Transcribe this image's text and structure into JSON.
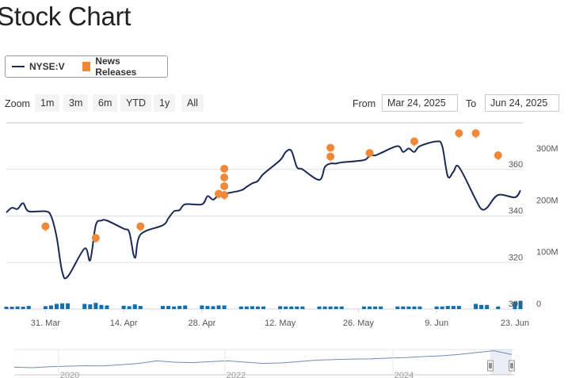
{
  "page": {
    "title": "Stock Chart"
  },
  "legend": {
    "series": "NYSE:V",
    "news": "News Releases"
  },
  "zoom": {
    "label": "Zoom",
    "buttons": [
      "1m",
      "3m",
      "6m",
      "YTD",
      "1y",
      "All"
    ]
  },
  "range": {
    "from_label": "From",
    "from_value": "Mar 24, 2025",
    "to_label": "To",
    "to_value": "Jun 24, 2025"
  },
  "colors": {
    "line": "#1a2a55",
    "news": "#f0883a",
    "volume": "#0f6ead",
    "navigator": "#6f8db8"
  },
  "chart_data": {
    "type": "line",
    "series": [
      {
        "name": "NYSE:V",
        "x": [
          "2025-03-24",
          "2025-03-25",
          "2025-03-26",
          "2025-03-27",
          "2025-03-28",
          "2025-03-31",
          "2025-04-01",
          "2025-04-02",
          "2025-04-03",
          "2025-04-04",
          "2025-04-07",
          "2025-04-08",
          "2025-04-09",
          "2025-04-10",
          "2025-04-11",
          "2025-04-14",
          "2025-04-15",
          "2025-04-16",
          "2025-04-17",
          "2025-04-21",
          "2025-04-22",
          "2025-04-23",
          "2025-04-24",
          "2025-04-25",
          "2025-04-28",
          "2025-04-29",
          "2025-04-30",
          "2025-05-01",
          "2025-05-02",
          "2025-05-05",
          "2025-05-06",
          "2025-05-07",
          "2025-05-08",
          "2025-05-09",
          "2025-05-12",
          "2025-05-13",
          "2025-05-14",
          "2025-05-15",
          "2025-05-16",
          "2025-05-19",
          "2025-05-20",
          "2025-05-21",
          "2025-05-22",
          "2025-05-23",
          "2025-05-27",
          "2025-05-28",
          "2025-05-29",
          "2025-05-30",
          "2025-06-02",
          "2025-06-03",
          "2025-06-04",
          "2025-06-05",
          "2025-06-06",
          "2025-06-09",
          "2025-06-10",
          "2025-06-11",
          "2025-06-12",
          "2025-06-13",
          "2025-06-16",
          "2025-06-17",
          "2025-06-18",
          "2025-06-20",
          "2025-06-23",
          "2025-06-24"
        ],
        "y": [
          341.5,
          343.5,
          343.0,
          345.5,
          342.0,
          342.0,
          340.0,
          331.0,
          316.0,
          314.0,
          326.0,
          321.0,
          336.0,
          338.0,
          338.0,
          334.5,
          333.0,
          322.0,
          332.0,
          336.0,
          339.0,
          342.0,
          342.5,
          345.0,
          345.0,
          348.5,
          347.0,
          349.0,
          349.5,
          351.0,
          352.5,
          354.0,
          355.0,
          358.0,
          364.0,
          367.5,
          368.0,
          361.0,
          360.0,
          355.5,
          361.0,
          362.5,
          362.5,
          363.0,
          364.0,
          366.0,
          366.0,
          367.0,
          370.0,
          367.5,
          369.0,
          367.5,
          370.0,
          372.0,
          370.0,
          357.0,
          359.0,
          361.0,
          347.0,
          343.0,
          343.5,
          349.0,
          348.0,
          351.0
        ]
      }
    ],
    "news_releases": [
      {
        "x": "2025-03-31",
        "y": 333.5,
        "stack": 1
      },
      {
        "x": "2025-04-09",
        "y": 328.5,
        "stack": 1
      },
      {
        "x": "2025-04-17",
        "y": 333.5,
        "stack": 1
      },
      {
        "x": "2025-05-01",
        "y": 347.5,
        "stack": 1
      },
      {
        "x": "2025-05-02",
        "y": 347.0,
        "stack": 4
      },
      {
        "x": "2025-05-21",
        "y": 363.5,
        "stack": 2
      },
      {
        "x": "2025-05-28",
        "y": 365.0,
        "stack": 1
      },
      {
        "x": "2025-06-05",
        "y": 370.0,
        "stack": 1
      },
      {
        "x": "2025-06-13",
        "y": 373.5,
        "stack": 1
      },
      {
        "x": "2025-06-16",
        "y": 373.5,
        "stack": 1
      },
      {
        "x": "2025-06-20",
        "y": 364.0,
        "stack": 1
      }
    ],
    "volume": [
      4.5,
      4.5,
      5,
      4.5,
      6,
      5.5,
      7,
      10,
      11,
      11,
      10,
      9,
      12,
      8,
      7,
      6.5,
      5.5,
      9,
      6,
      6,
      6,
      5,
      6,
      7,
      7,
      6,
      5.5,
      7,
      7,
      5,
      5,
      5.5,
      5,
      5,
      5.5,
      5,
      5,
      5,
      5,
      5,
      5,
      5,
      5,
      5,
      5,
      5,
      5,
      5,
      5,
      5,
      5,
      5,
      5,
      5,
      5,
      6,
      6,
      6,
      10,
      8,
      8,
      5,
      14,
      16
    ],
    "x_ticks": [
      {
        "x": "2025-03-31",
        "label": "31. Mar"
      },
      {
        "x": "2025-04-14",
        "label": "14. Apr"
      },
      {
        "x": "2025-04-28",
        "label": "28. Apr"
      },
      {
        "x": "2025-05-12",
        "label": "12. May"
      },
      {
        "x": "2025-05-26",
        "label": "26. May"
      },
      {
        "x": "2025-06-09",
        "label": "9. Jun"
      },
      {
        "x": "2025-06-23",
        "label": "23. Jun"
      }
    ],
    "price_ticks": [
      "300",
      "320",
      "340",
      "360"
    ],
    "volume_ticks": [
      "0",
      "100M",
      "200M",
      "300M"
    ],
    "price_range": [
      300,
      380
    ],
    "volume_range": [
      0,
      360
    ],
    "navigator": {
      "labels": [
        "2020",
        "2022",
        "2024"
      ],
      "values": [
        0.3,
        0.28,
        0.32,
        0.34,
        0.36,
        0.35,
        0.4,
        0.45,
        0.55,
        0.5,
        0.48,
        0.52,
        0.55,
        0.5,
        0.45,
        0.47,
        0.52,
        0.58,
        0.6,
        0.62,
        0.63,
        0.66,
        0.68,
        0.72,
        0.75,
        0.8,
        0.88,
        0.95,
        0.8
      ]
    },
    "grid": true
  }
}
